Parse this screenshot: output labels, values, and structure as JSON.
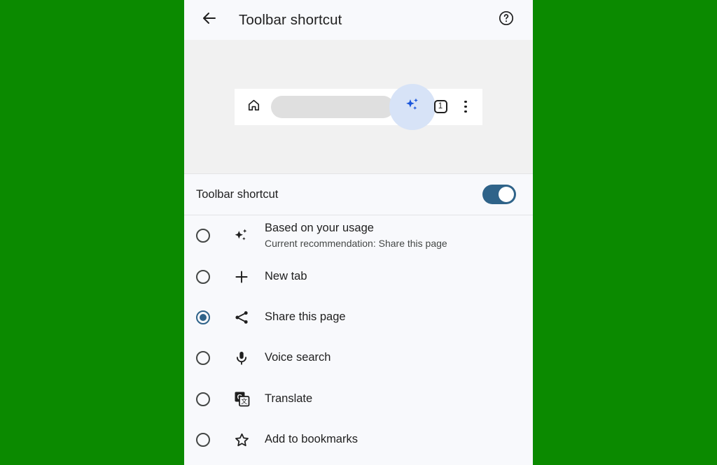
{
  "background_color": "#0b8a00",
  "accent_color": "#2f6389",
  "appbar": {
    "back_icon": "arrow-back-icon",
    "title": "Toolbar shortcut",
    "help_icon": "help-circle-icon"
  },
  "preview": {
    "home_icon": "home-icon",
    "omnibox_placeholder": "",
    "sparkle_icon": "sparkle-ai-icon",
    "sparkle_highlight_color": "#d7e3f7",
    "sparkle_icon_color": "#1a56db",
    "tab_count": "1",
    "menu_icon": "overflow-menu-icon"
  },
  "master_toggle": {
    "label": "Toolbar shortcut",
    "enabled": true
  },
  "options": [
    {
      "id": "based-on-your-usage",
      "icon": "sparkle-icon",
      "title": "Based on your usage",
      "subtitle": "Current recommendation:  Share this page",
      "selected": false
    },
    {
      "id": "new-tab",
      "icon": "plus-icon",
      "title": "New tab",
      "subtitle": "",
      "selected": false
    },
    {
      "id": "share-this-page",
      "icon": "share-icon",
      "title": "Share this page",
      "subtitle": "",
      "selected": true
    },
    {
      "id": "voice-search",
      "icon": "microphone-icon",
      "title": "Voice search",
      "subtitle": "",
      "selected": false
    },
    {
      "id": "translate",
      "icon": "translate-icon",
      "title": "Translate",
      "subtitle": "",
      "selected": false
    },
    {
      "id": "add-to-bookmarks",
      "icon": "star-outline-icon",
      "title": "Add to bookmarks",
      "subtitle": "",
      "selected": false
    }
  ]
}
